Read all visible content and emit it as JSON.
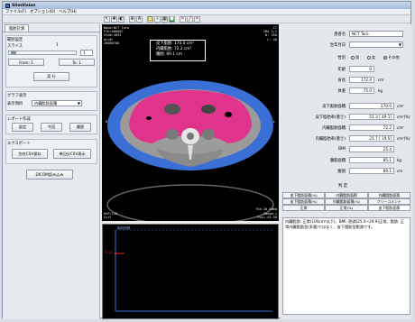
{
  "app": {
    "title": "SlimVision"
  },
  "menu": [
    "ファイル(F)",
    "オプション(O)",
    "ヘルプ(H)"
  ],
  "left": {
    "tab_label": "脂肪計測",
    "range_group": "範囲設定",
    "slice_label": "スライス",
    "slice_value": "1",
    "slice_input": "1",
    "from_button": "From: 1",
    "to_button": "To: 1",
    "run_button": "実 行",
    "graph_group": "グラフ表示",
    "display_label": "表示項目",
    "display_select": "内臓脂肪面積",
    "report_group": "レポート作成",
    "settings_button": "設定",
    "today_button": "今回",
    "history_button": "履歴",
    "export_group": "エクスポート",
    "csv_save_button": "別名CSV保存",
    "single_csv_button": "単回分CSV表示",
    "dicom_button": "DICOM読み込み"
  },
  "viewer": {
    "overlay_left": [
      "Name:NCT Taro",
      "PID:000007",
      "Std#:4894",
      "Acc#:",
      "20080708"
    ],
    "overlay_right": [
      "CT",
      "IMA 1/1",
      "W: 350",
      "L: 40"
    ],
    "measure_labels": [
      "皮下脂肪",
      "内臓脂肪",
      "腹囲"
    ],
    "measure_values": [
      "170.0 cm²",
      "72.2 cm²",
      "89.1 cm"
    ],
    "bottom_left": [
      "KVP:120",
      "Curl"
    ],
    "bottom_right": [
      "Thk:10.00mm",
      "Image:1",
      "Pos=-44.50"
    ],
    "marker_left": "R",
    "marker_right": "L"
  },
  "graph": {
    "y_label": "脂肪面積",
    "marker": "72.22"
  },
  "right": {
    "fields": [
      {
        "label": "患者名",
        "value": "NCT Taro",
        "unit": ""
      },
      {
        "label": "生年月日",
        "value": "",
        "unit": ""
      }
    ],
    "sex_label": "性別",
    "sex_options": [
      "男",
      "女",
      "その他"
    ],
    "rows": [
      {
        "label": "年齢",
        "value": "0",
        "unit": ""
      },
      {
        "label": "身長",
        "value": "172.0",
        "unit": "cm"
      },
      {
        "label": "体重",
        "value": "75.0",
        "unit": "kg"
      },
      {
        "label": "皮下脂肪面積",
        "value": "170.0",
        "unit": "cm²"
      },
      {
        "label": "皮下脂肪率(重さ)",
        "value": "51.3 [ 49.1]",
        "unit": "cm²(%)"
      },
      {
        "label": "内臓脂肪面積",
        "value": "72.2",
        "unit": "cm²"
      },
      {
        "label": "内臓脂肪率(重さ)",
        "value": "21.7 [ 19.5]",
        "unit": "cm²(%)"
      },
      {
        "label": "BMI",
        "value": "25.4",
        "unit": ""
      },
      {
        "label": "腹筋面積",
        "value": "85.1",
        "unit": "kg"
      },
      {
        "label": "腹囲",
        "value": "89.1",
        "unit": "cm"
      }
    ],
    "judge_label": "判 定",
    "tabs_row1": [
      "皮下脂肪面積(%)",
      "内臓脂肪面積",
      "内臓脂肪面積"
    ],
    "tabs_row2": [
      "皮下脂肪面積(%)",
      "内臓脂肪面積(%)",
      "フリーコメント"
    ],
    "tabs_row3": [
      "正常",
      "正常(%)",
      "皮下脂肪面積"
    ],
    "comment": "内臓脂肪: 正常(100cm²以下)、BMI: 肥満(25.0~29.9)正常。脂肪: 正常内臓脂肪型(多量)ではなく、皮下脂肪型肥満です。"
  },
  "colors": {
    "subcutaneous": "#3a6fd6",
    "visceral": "#e0338c",
    "muscle": "#9b9b9b",
    "graph_axis": "#3a6fd6",
    "graph_marker": "#e03030"
  }
}
